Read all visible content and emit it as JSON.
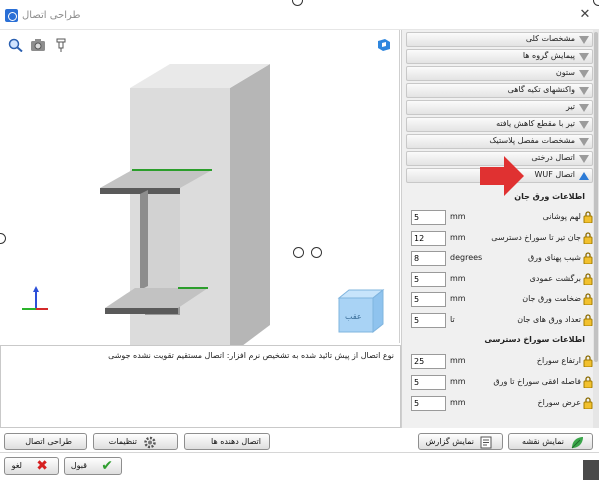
{
  "window": {
    "title": "طراحی اتصال",
    "close_glyph": "✕"
  },
  "viewport": {
    "toolbar": [
      "zoom-icon",
      "camera-icon",
      "pin-icon"
    ],
    "view_cube_face_label": "عقب"
  },
  "description": "نوع اتصال از پیش تائید شده به تشخیص نرم افزار: اتصال مستقیم تقویت نشده جوشی",
  "sections": [
    {
      "label": "مشخصات کلی",
      "open": false
    },
    {
      "label": "پیمایش گروه ها",
      "open": false
    },
    {
      "label": "ستون",
      "open": false
    },
    {
      "label": "واکنشهای تکیه گاهی",
      "open": false
    },
    {
      "label": "تیر",
      "open": false
    },
    {
      "label": "تیر با مقطع کاهش یافته",
      "open": false
    },
    {
      "label": "مشخصات مفصل پلاستیک",
      "open": false
    },
    {
      "label": "اتصال درختی",
      "open": false
    },
    {
      "label": "اتصال WUF",
      "open": true
    }
  ],
  "web_plate_group": {
    "title": "اطلاعات ورق جان",
    "fields": [
      {
        "label": "لهم پوشانی",
        "value": "5",
        "unit": "mm"
      },
      {
        "label": "جان تیر تا سوراخ دسترسی",
        "value": "12",
        "unit": "mm"
      },
      {
        "label": "شیب پهنای ورق",
        "value": "8",
        "unit": "degrees"
      },
      {
        "label": "برگشت عمودی",
        "value": "5",
        "unit": "mm"
      },
      {
        "label": "ضخامت ورق جان",
        "value": "5",
        "unit": "mm"
      },
      {
        "label": "تعداد ورق های جان",
        "value": "5",
        "unit": "تا"
      }
    ]
  },
  "access_hole_group": {
    "title": "اطلاعات سوراخ دسترسی",
    "fields": [
      {
        "label": "ارتفاع سوراخ",
        "value": "25",
        "unit": "mm"
      },
      {
        "label": "فاصله افقی سوراخ تا ورق",
        "value": "5",
        "unit": "mm"
      },
      {
        "label": "عرض سوراخ",
        "value": "5",
        "unit": "mm"
      }
    ]
  },
  "bottom_buttons": {
    "design_connection": "طراحی اتصال",
    "settings": "تنظیمات",
    "connecting_beams": "اتصال دهنده ها",
    "show_report": "نمایش گزارش",
    "show_drawing": "نمایش نقشه"
  },
  "dialog_buttons": {
    "cancel": "لغو",
    "accept": "قبول"
  },
  "colors": {
    "accent_blue": "#2d7bd6",
    "red_arrow": "#e03131",
    "check_green": "#2f9e2f",
    "cancel_red": "#d62020",
    "axis_x": "#d42a2a",
    "axis_y": "#2bb32b",
    "axis_z": "#2c4fd8"
  }
}
